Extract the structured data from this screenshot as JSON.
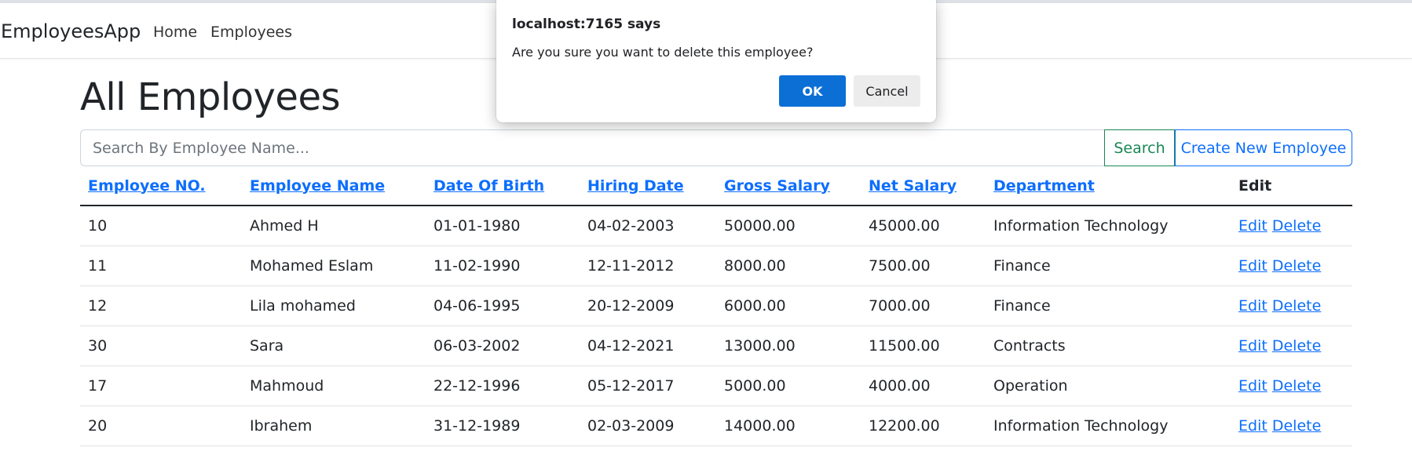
{
  "navbar": {
    "brand": "EmployeesApp",
    "links": [
      "Home",
      "Employees"
    ]
  },
  "page": {
    "title": "All Employees"
  },
  "search": {
    "placeholder": "Search By Employee Name...",
    "value": "",
    "search_label": "Search",
    "create_label": "Create New Employee"
  },
  "table": {
    "headers": [
      "Employee NO.",
      "Employee Name",
      "Date Of Birth",
      "Hiring Date",
      "Gross Salary",
      "Net Salary",
      "Department",
      "Edit"
    ],
    "edit_label": "Edit",
    "delete_label": "Delete",
    "rows": [
      {
        "no": "10",
        "name": "Ahmed H",
        "dob": "01-01-1980",
        "hired": "04-02-2003",
        "gross": "50000.00",
        "net": "45000.00",
        "dept": "Information Technology"
      },
      {
        "no": "11",
        "name": "Mohamed Eslam",
        "dob": "11-02-1990",
        "hired": "12-11-2012",
        "gross": "8000.00",
        "net": "7500.00",
        "dept": "Finance"
      },
      {
        "no": "12",
        "name": "Lila mohamed",
        "dob": "04-06-1995",
        "hired": "20-12-2009",
        "gross": "6000.00",
        "net": "7000.00",
        "dept": "Finance"
      },
      {
        "no": "30",
        "name": "Sara",
        "dob": "06-03-2002",
        "hired": "04-12-2021",
        "gross": "13000.00",
        "net": "11500.00",
        "dept": "Contracts"
      },
      {
        "no": "17",
        "name": "Mahmoud",
        "dob": "22-12-1996",
        "hired": "05-12-2017",
        "gross": "5000.00",
        "net": "4000.00",
        "dept": "Operation"
      },
      {
        "no": "20",
        "name": "Ibrahem",
        "dob": "31-12-1989",
        "hired": "02-03-2009",
        "gross": "14000.00",
        "net": "12200.00",
        "dept": "Information Technology"
      }
    ]
  },
  "dialog": {
    "title": "localhost:7165 says",
    "message": "Are you sure you want to delete this employee?",
    "ok_label": "OK",
    "cancel_label": "Cancel"
  },
  "colors": {
    "primary": "#0d6efd",
    "success": "#198754",
    "dialog_ok": "#0b6fd6",
    "text": "#212529"
  }
}
